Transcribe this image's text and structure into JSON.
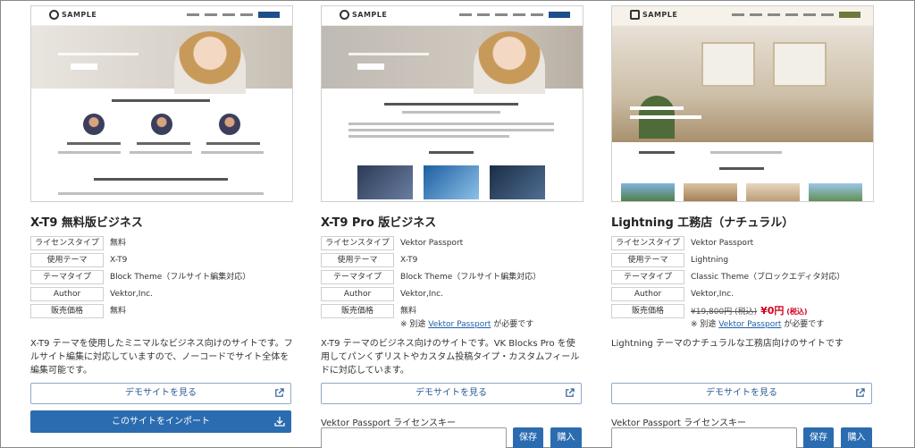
{
  "labels": {
    "license_type": "ライセンスタイプ",
    "theme": "使用テーマ",
    "theme_type": "テーマタイプ",
    "author": "Author",
    "price": "販売価格"
  },
  "common": {
    "demo_button": "デモサイトを見る",
    "import_button": "このサイトをインポート",
    "license_key_label": "Vektor Passport ライセンスキー",
    "save_button": "保存",
    "buy_button": "購入",
    "note_prefix": "※ 別途 ",
    "note_link": "Vektor Passport",
    "note_suffix": " が必要です"
  },
  "cards": [
    {
      "title": "X-T9 無料版ビジネス",
      "thumb_logo": "SAMPLE",
      "license_type": "無料",
      "theme": "X-T9",
      "theme_type": "Block Theme（フルサイト編集対応）",
      "author": "Vektor,Inc.",
      "price": "無料",
      "description": "X-T9 テーマを使用したミニマルなビジネス向けのサイトです。フルサイト編集に対応していますので、ノーコードでサイト全体を編集可能です。"
    },
    {
      "title": "X-T9 Pro 版ビジネス",
      "thumb_logo": "SAMPLE",
      "license_type": "Vektor Passport",
      "theme": "X-T9",
      "theme_type": "Block Theme（フルサイト編集対応）",
      "author": "Vektor,Inc.",
      "price": "無料",
      "description": "X-T9 テーマのビジネス向けのサイトです。VK Blocks Pro を使用してパンくずリストやカスタム投稿タイプ・カスタムフィールドに対応しています。"
    },
    {
      "title": "Lightning 工務店（ナチュラル）",
      "thumb_logo": "SAMPLE",
      "license_type": "Vektor Passport",
      "theme": "Lightning",
      "theme_type": "Classic Theme（ブロックエディタ対応）",
      "author": "Vektor,Inc.",
      "price_original": "¥19,800円 (税込)",
      "price_sale": "¥0円",
      "price_sale_tax": " (税込)",
      "description": "Lightning テーマのナチュラルな工務店向けのサイトです"
    }
  ],
  "colors": {
    "primary": "#2b6cb0",
    "link": "#1f5fa8",
    "sale": "#d0021b"
  }
}
